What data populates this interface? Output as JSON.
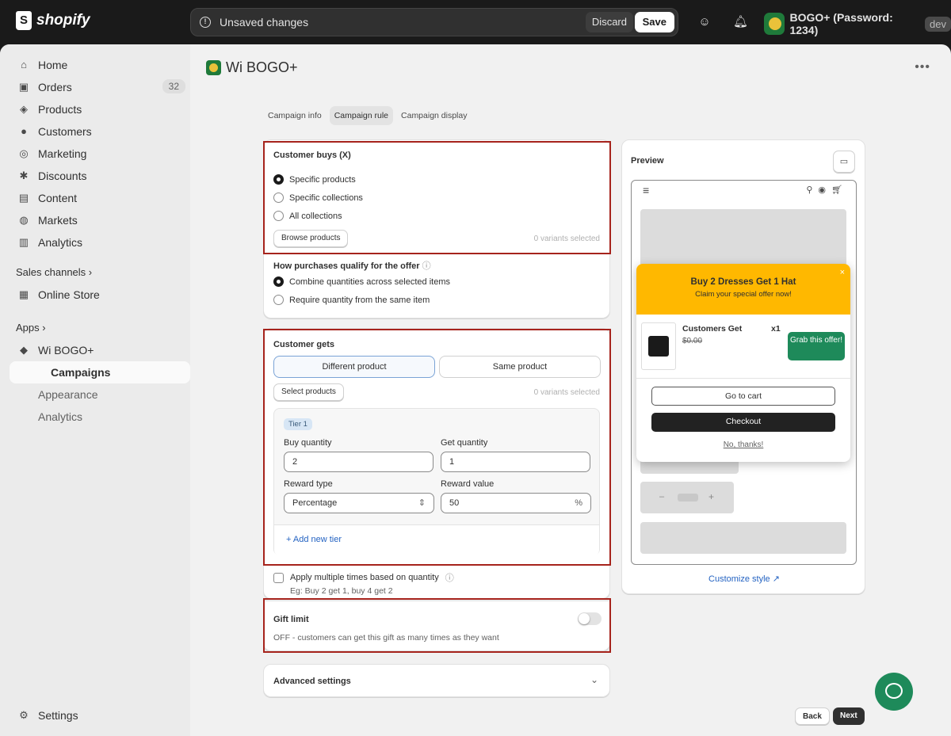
{
  "topbar": {
    "logo": "shopify",
    "unsaved_text": "Unsaved changes",
    "discard": "Discard",
    "save": "Save",
    "store_name": "BOGO+ (Password: 1234)",
    "env_badge": "dev"
  },
  "sidebar": {
    "items": [
      {
        "label": "Home",
        "icon": "home-icon"
      },
      {
        "label": "Orders",
        "icon": "orders-icon",
        "badge": "32"
      },
      {
        "label": "Products",
        "icon": "tag-icon"
      },
      {
        "label": "Customers",
        "icon": "person-icon"
      },
      {
        "label": "Marketing",
        "icon": "target-icon"
      },
      {
        "label": "Discounts",
        "icon": "discount-icon"
      },
      {
        "label": "Content",
        "icon": "image-icon"
      },
      {
        "label": "Markets",
        "icon": "globe-icon"
      },
      {
        "label": "Analytics",
        "icon": "chart-icon"
      }
    ],
    "sales_channels": "Sales channels",
    "online_store": "Online Store",
    "apps": "Apps",
    "app_name": "Wi BOGO+",
    "app_sub": [
      "Campaigns",
      "Appearance",
      "Analytics"
    ],
    "settings": "Settings"
  },
  "page": {
    "title": "Wi BOGO+",
    "tabs": [
      "Campaign info",
      "Campaign rule",
      "Campaign display"
    ],
    "active_tab": "Campaign rule"
  },
  "customer_buys": {
    "title": "Customer buys (X)",
    "options": [
      "Specific products",
      "Specific collections",
      "All collections"
    ],
    "selected": "Specific products",
    "browse": "Browse products",
    "variants": "0 variants selected",
    "qualify_title": "How purchases qualify for the offer",
    "qualify_options": [
      "Combine quantities across selected items",
      "Require quantity from the same item"
    ],
    "qualify_selected": "Combine quantities across selected items"
  },
  "customer_gets": {
    "title": "Customer gets",
    "seg": [
      "Different product",
      "Same product"
    ],
    "seg_selected": "Different product",
    "select": "Select products",
    "variants": "0 variants selected",
    "tier": {
      "badge": "Tier 1",
      "buy_label": "Buy quantity",
      "buy_value": "2",
      "get_label": "Get quantity",
      "get_value": "1",
      "reward_type_label": "Reward type",
      "reward_type_value": "Percentage",
      "reward_value_label": "Reward value",
      "reward_value": "50",
      "reward_suffix": "%"
    },
    "add_tier": "+ Add new tier",
    "apply_multiple": "Apply multiple times based on quantity",
    "apply_example": "Eg: Buy 2 get 1, buy 4 get 2"
  },
  "gift_limit": {
    "title": "Gift limit",
    "desc": "OFF - customers can get this gift as many times as they want",
    "enabled": false
  },
  "advanced": {
    "title": "Advanced settings"
  },
  "preview": {
    "title": "Preview",
    "banner_title": "Buy 2 Dresses Get 1 Hat",
    "banner_sub": "Claim your special offer now!",
    "product_name": "Customers Get",
    "qty": "x1",
    "price": "$0.00",
    "grab": "Grab this offer!",
    "go_cart": "Go to cart",
    "checkout": "Checkout",
    "no_thanks": "No, thanks!",
    "stepper_minus": "–",
    "stepper_plus": "+",
    "customize": "Customize style"
  },
  "footer": {
    "back": "Back",
    "next": "Next"
  },
  "colors": {
    "banner": "#ffb800",
    "grab": "#1e8a5a",
    "highlight": "#a6231c"
  }
}
